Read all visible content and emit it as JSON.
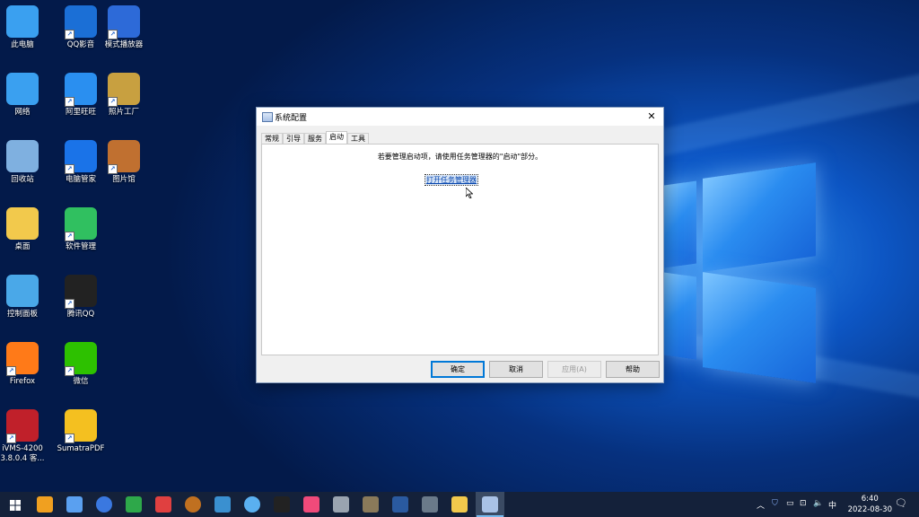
{
  "desktop_icons": [
    {
      "label": "此电脑",
      "icon": "this-pc-icon",
      "color": "#3aa0f0"
    },
    {
      "label": "QQ影音",
      "icon": "qq-player-icon",
      "color": "#1b6fd6"
    },
    {
      "label": "模式播放器",
      "icon": "video-player-icon",
      "color": "#2d6ad8"
    },
    {
      "label": "网络",
      "icon": "network-icon",
      "color": "#3aa0f0"
    },
    {
      "label": "阿里旺旺",
      "icon": "aliwangwang-icon",
      "color": "#2a8ff0"
    },
    {
      "label": "照片工厂",
      "icon": "photo-factory-icon",
      "color": "#c8a040"
    },
    {
      "label": "回收站",
      "icon": "recycle-bin-icon",
      "color": "#7fb0e0"
    },
    {
      "label": "电脑管家",
      "icon": "pc-manager-icon",
      "color": "#1a73e8"
    },
    {
      "label": "图片馆",
      "icon": "picture-gallery-icon",
      "color": "#c07030"
    },
    {
      "label": "桌面",
      "icon": "folder-icon",
      "color": "#f2c94c"
    },
    {
      "label": "软件管理",
      "icon": "software-manager-icon",
      "color": "#30c060"
    },
    {
      "label": "控制面板",
      "icon": "control-panel-icon",
      "color": "#4aa8e8"
    },
    {
      "label": "腾讯QQ",
      "icon": "qq-penguin-icon",
      "color": "#222222"
    },
    {
      "label": "Firefox",
      "icon": "firefox-icon",
      "color": "#ff7a18"
    },
    {
      "label": "微信",
      "icon": "wechat-icon",
      "color": "#2dc100"
    },
    {
      "label": "iVMS-4200\n3.8.0.4 客...",
      "icon": "ivms-icon",
      "color": "#c0202a"
    },
    {
      "label": "SumatraPDF",
      "icon": "pdf-icon",
      "color": "#f4c020"
    }
  ],
  "dialog": {
    "title": "系统配置",
    "close_glyph": "✕",
    "tabs": [
      {
        "label": "常规"
      },
      {
        "label": "引导"
      },
      {
        "label": "服务"
      },
      {
        "label": "启动"
      },
      {
        "label": "工具"
      }
    ],
    "active_tab": "启动",
    "message": "若要管理启动项，请使用任务管理器的\"启动\"部分。",
    "link": "打开任务管理器",
    "buttons": {
      "ok": "确定",
      "cancel": "取消",
      "apply": "应用(A)",
      "help": "帮助"
    }
  },
  "taskbar": {
    "tray_ime": "中",
    "tray_volume": "🔈",
    "time": "6:40",
    "date": "2022-08-30"
  },
  "colors": {
    "accent": "#0078d7",
    "link": "#0645ad",
    "taskbar": "#14213a"
  }
}
